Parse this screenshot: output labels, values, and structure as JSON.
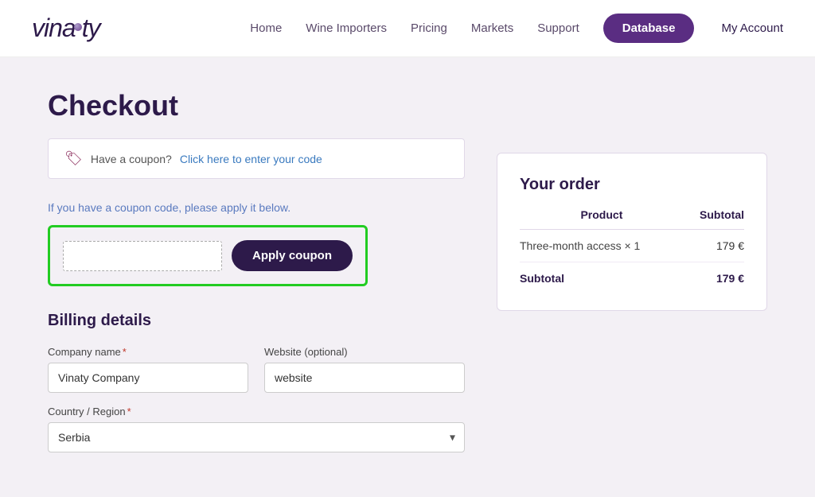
{
  "header": {
    "logo_text": "vinaty",
    "nav": {
      "home": "Home",
      "wine_importers": "Wine Importers",
      "pricing": "Pricing",
      "markets": "Markets",
      "support": "Support",
      "database_btn": "Database",
      "my_account": "My Account"
    }
  },
  "page": {
    "title": "Checkout"
  },
  "coupon_notice": {
    "text": "Have a coupon?",
    "link_text": "Click here to enter your code"
  },
  "coupon_section": {
    "instruction": "If you have a coupon code, please apply it below.",
    "input_placeholder": "",
    "apply_btn": "Apply coupon"
  },
  "billing": {
    "title": "Billing details",
    "company_name_label": "Company name",
    "company_name_value": "Vinaty Company",
    "website_label": "Website (optional)",
    "website_value": "website",
    "country_label": "Country / Region",
    "country_value": "Serbia"
  },
  "your_order": {
    "title": "Your order",
    "col_product": "Product",
    "col_subtotal": "Subtotal",
    "rows": [
      {
        "product": "Three-month access × 1",
        "subtotal": "179 €"
      }
    ],
    "subtotal_label": "Subtotal",
    "subtotal_value": "179 €"
  }
}
